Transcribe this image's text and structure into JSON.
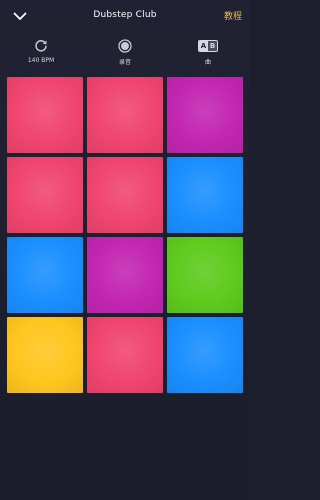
{
  "header": {
    "title": "Dubstep Club",
    "tutorial_label": "教程"
  },
  "toolbar": {
    "tempo_label": "140 BPM",
    "record_label": "录音",
    "ab_label": "曲",
    "ab_icon_a": "A",
    "ab_icon_b": "B"
  },
  "icons": {
    "back": "chevron-down-icon",
    "tempo": "refresh-icon",
    "record": "record-icon",
    "ab": "ab-switch-icon"
  },
  "colors": {
    "background": "#1d1e2e",
    "accent": "#f1b640",
    "pink": "#f0456e",
    "magenta": "#c226b2",
    "blue": "#1a8fff",
    "green": "#5ecb1d",
    "yellow": "#ffc61f"
  },
  "pads": [
    {
      "color": "pink"
    },
    {
      "color": "pink"
    },
    {
      "color": "magenta"
    },
    {
      "color": "pink"
    },
    {
      "color": "pink"
    },
    {
      "color": "blue"
    },
    {
      "color": "blue"
    },
    {
      "color": "magenta"
    },
    {
      "color": "green"
    },
    {
      "color": "yellow"
    },
    {
      "color": "pink"
    },
    {
      "color": "blue"
    }
  ]
}
